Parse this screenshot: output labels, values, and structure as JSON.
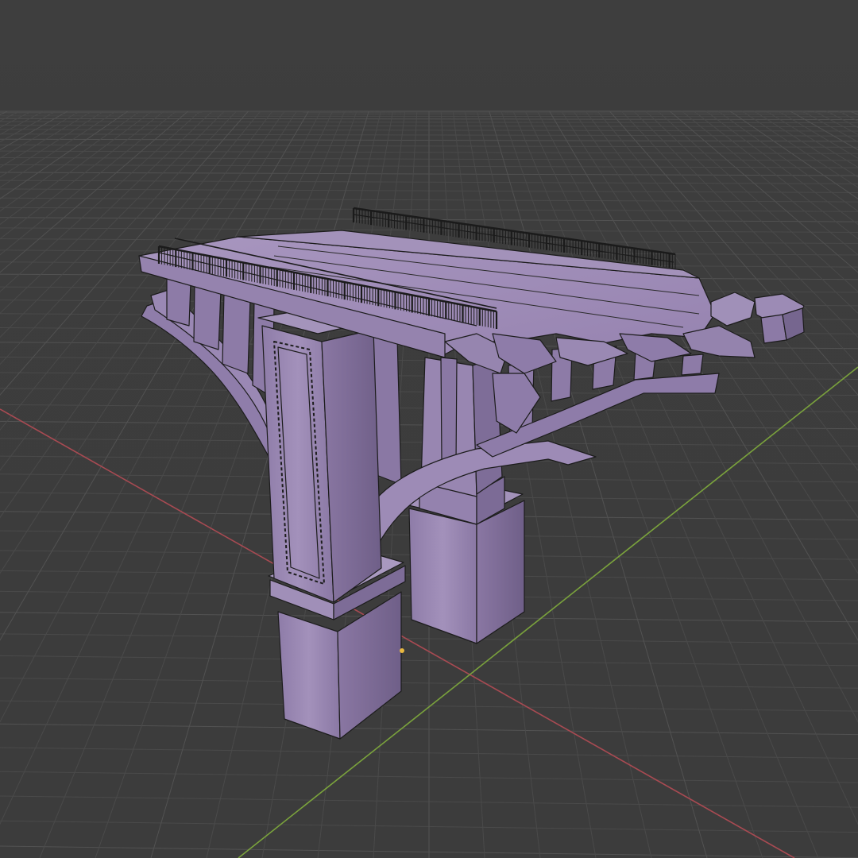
{
  "viewport": {
    "mode": "3d-viewport",
    "shading": "solid",
    "overlays": [
      "grid-floor",
      "x-axis-line",
      "y-axis-line",
      "wireframe-edges"
    ],
    "colors": {
      "background": "#3d3d3d",
      "grid": "#4a4a4a",
      "grid_major": "#525252",
      "x_axis": "#a84a52",
      "y_axis": "#7aa23c",
      "mesh_fill": "#9a87b3",
      "mesh_fill_light": "#a897be",
      "mesh_fill_dark": "#7e6d98",
      "wire": "#1b1b1b",
      "origin_point": "#e8b840"
    }
  },
  "model": {
    "icon": "bridge-pier-mesh-icon",
    "parts": [
      "deck",
      "railing-left",
      "railing-right",
      "pier-front",
      "pier-back",
      "arch-support",
      "broken-edge-debris"
    ]
  }
}
